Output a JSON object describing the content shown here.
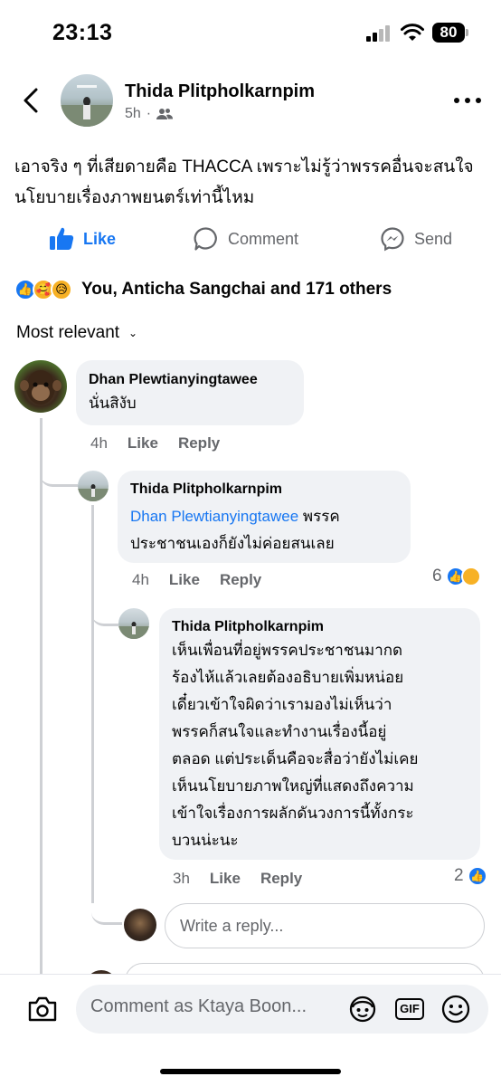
{
  "status_bar": {
    "time": "23:13",
    "battery": "80"
  },
  "post": {
    "author": "Thida Plitpholkarnpim",
    "time": "5h",
    "audience_icon": "friends-icon",
    "text": "เอาจริง ๆ ที่เสียดายคือ THACCA เพราะไม่รู้ว่าพรรคอื่นจะสนใจนโยบายเรื่องภาพยนตร์เท่านี้ไหม",
    "actions": {
      "like": "Like",
      "comment": "Comment",
      "send": "Send"
    },
    "reactions_text": "You, Anticha Sangchai and 171 others"
  },
  "sort_label": "Most relevant",
  "comments": [
    {
      "name": "Dhan Plewtianyingtawee",
      "text": "นั่นสิงับ",
      "time": "4h",
      "like": "Like",
      "reply": "Reply"
    },
    {
      "name": "Thida Plitpholkarnpim",
      "mention": "Dhan Plewtianyingtawee",
      "text_line1_rest": " พรรค",
      "text_line2": "ประชาชนเองก็ยังไม่ค่อยสนเลย",
      "time": "4h",
      "like": "Like",
      "reply": "Reply",
      "reaction_count": "6"
    },
    {
      "name": "Thida Plitpholkarnpim",
      "lines": [
        "เห็นเพื่อนที่อยู่พรรคประชาชนมากด",
        "ร้องไห้แล้วเลยต้องอธิบายเพิ่มหน่อย",
        "เดี๋ยวเข้าใจผิดว่าเรามองไม่เห็นว่า",
        "พรรคก็สนใจและทำงานเรื่องนี้อยู่",
        "ตลอด แต่ประเด็นคือจะสื่อว่ายังไม่เคย",
        "เห็นนโยบายภาพใหญ่ที่แสดงถึงความ",
        "เข้าใจเรื่องการผลักดันวงการนี้ทั้งกระ",
        "บวนน่ะนะ"
      ],
      "time": "3h",
      "like": "Like",
      "reply": "Reply",
      "reaction_count": "2"
    }
  ],
  "reply_placeholder": "Write a reply...",
  "comment_placeholder": "Comment as Ktaya Boon...",
  "gif_label": "GIF"
}
